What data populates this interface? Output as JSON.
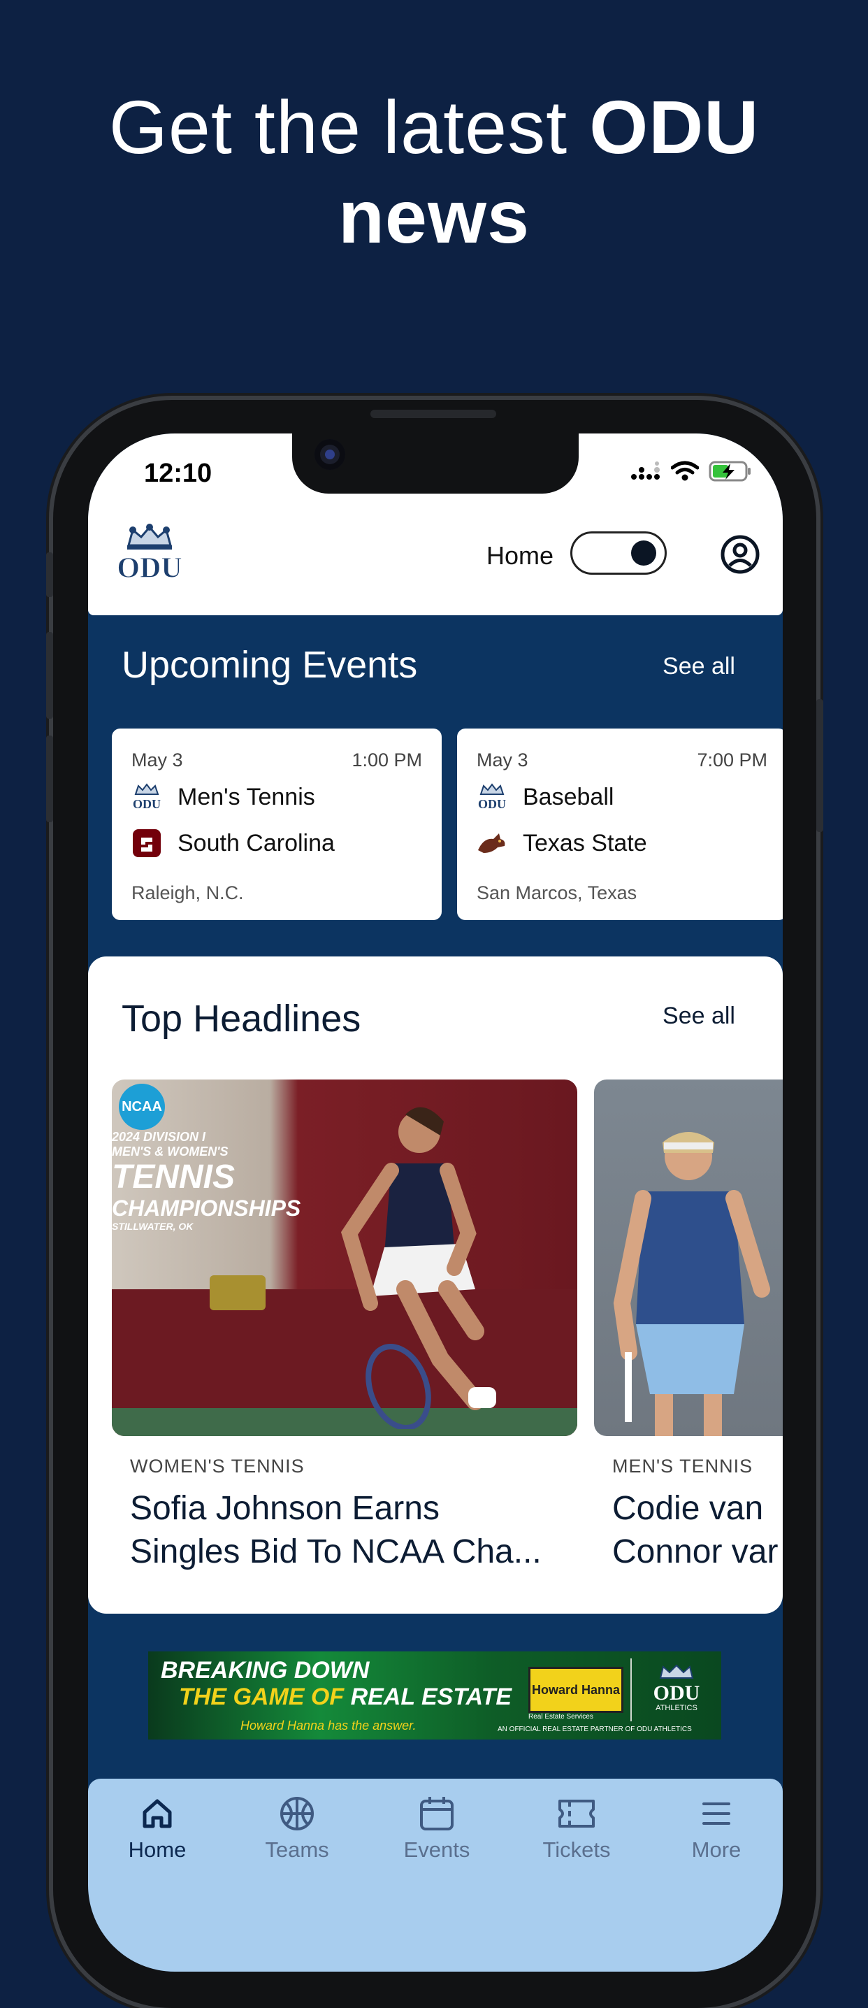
{
  "promo": {
    "title_regular": "Get the latest ",
    "title_bold_1": "ODU",
    "title_bold_2": "news"
  },
  "status_bar": {
    "time": "12:10"
  },
  "header": {
    "logo_text": "ODU",
    "mode_label": "Home",
    "toggle_state": "on"
  },
  "upcoming": {
    "title": "Upcoming Events",
    "see_all": "See all",
    "events": [
      {
        "date": "May 3",
        "time": "1:00 PM",
        "home_team": "Men's Tennis",
        "opponent": "South Carolina",
        "location": "Raleigh, N.C."
      },
      {
        "date": "May 3",
        "time": "7:00 PM",
        "home_team": "Baseball",
        "opponent": "Texas State",
        "location": "San Marcos, Texas"
      }
    ]
  },
  "headlines": {
    "title": "Top Headlines",
    "see_all": "See all",
    "items": [
      {
        "category": "WOMEN'S TENNIS",
        "title_line1": "Sofia Johnson Earns",
        "title_line2": "Singles Bid To NCAA Cha...",
        "image_overlay": {
          "badge": "NCAA",
          "line1": "2024 DIVISION I",
          "line2": "MEN'S & WOMEN'S",
          "line3": "TENNIS",
          "line4": "CHAMPIONSHIPS",
          "line5": "STILLWATER, OK"
        }
      },
      {
        "category": "MEN'S TENNIS",
        "title_line1": "Codie van",
        "title_line2": "Connor var"
      }
    ]
  },
  "ad": {
    "line1": "BREAKING DOWN",
    "line2a": "THE GAME OF ",
    "line2b": "REAL ESTATE",
    "tagline": "Howard Hanna has the answer.",
    "brand": "Howard Hanna",
    "brand_sub": "Real Estate Services",
    "partner_logo": "ODU",
    "partner_sub": "ATHLETICS",
    "footer": "AN OFFICIAL REAL ESTATE PARTNER OF ODU ATHLETICS"
  },
  "tabs": [
    {
      "label": "Home",
      "icon": "home-icon",
      "active": true
    },
    {
      "label": "Teams",
      "icon": "basketball-icon",
      "active": false
    },
    {
      "label": "Events",
      "icon": "calendar-icon",
      "active": false
    },
    {
      "label": "Tickets",
      "icon": "ticket-icon",
      "active": false
    },
    {
      "label": "More",
      "icon": "menu-icon",
      "active": false
    }
  ],
  "colors": {
    "background": "#0d2143",
    "content_bg": "#0c3461",
    "tab_bar": "#a8cdee",
    "ad_green": "#148a3a",
    "ad_yellow": "#f2d21b"
  }
}
